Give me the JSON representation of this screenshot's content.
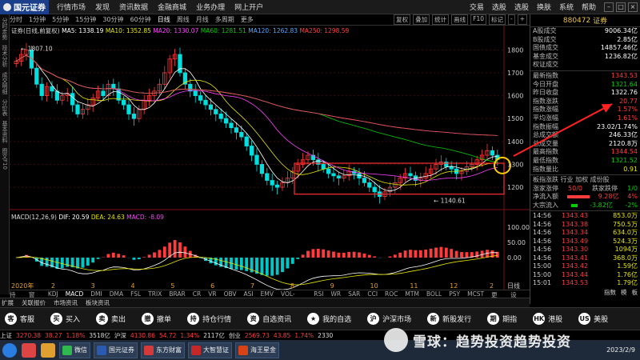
{
  "app": {
    "brand": "国元证券",
    "brand_sub": "GUOYUAN SECURITIES"
  },
  "top_menu": [
    "行情市场",
    "发现",
    "资讯数据",
    "金融商城",
    "业务办理",
    "网上开户"
  ],
  "top_right_menu": [
    "交易",
    "选股",
    "选股",
    "换肤",
    "系统",
    "帮助"
  ],
  "periods": [
    "分时",
    "1分钟",
    "5分钟",
    "15分钟",
    "30分钟",
    "60分钟",
    "日线",
    "周线",
    "月线",
    "多周期",
    "更多"
  ],
  "active_period": "日线",
  "chart_tools": [
    "复权",
    "叠加",
    "统计",
    "画线",
    "F10",
    "标记",
    "-",
    "+"
  ],
  "left_tabs": [
    "分时走势",
    "技术分析",
    "成交明细",
    "分价表",
    "基本资料",
    "图文F10"
  ],
  "ma_legend": {
    "title": "证券(日线,前复权)",
    "items": [
      {
        "label": "MA5: 1338.19",
        "color": "#ffffff"
      },
      {
        "label": "MA10: 1352.85",
        "color": "#e6e600"
      },
      {
        "label": "MA20: 1330.07",
        "color": "#ff40ff"
      },
      {
        "label": "MA60: 1281.51",
        "color": "#00d000"
      },
      {
        "label": "MA120: 1262.83",
        "color": "#4fa8ff"
      },
      {
        "label": "MA250: 1298.59",
        "color": "#ff4040"
      }
    ]
  },
  "macd_legend": {
    "title": "MACD(12,26,9)",
    "dif": "DIF: 20.59",
    "dea": "DEA: 24.63",
    "macd": "MACD: -8.09"
  },
  "annotations": {
    "high": "1807.10",
    "low": "1140.61"
  },
  "chart_data": {
    "type": "candlestick",
    "y_ticks": [
      1800,
      1700,
      1600,
      1500,
      1400,
      1300,
      1200
    ],
    "macd_y_ticks": [
      "100.00",
      "50.00",
      "0.00"
    ],
    "x_labels": [
      "2020年",
      "2",
      "3",
      "4",
      "5",
      "6",
      "7",
      "8",
      "9",
      "10",
      "11",
      "12",
      "2"
    ],
    "x_right_label": "日线",
    "high": 1807.1,
    "low": 1140.61,
    "close": [
      1750,
      1780,
      1800,
      1720,
      1650,
      1600,
      1640,
      1620,
      1580,
      1600,
      1610,
      1560,
      1520,
      1540,
      1560,
      1590,
      1620,
      1600,
      1650,
      1630,
      1580,
      1560,
      1520,
      1500,
      1540,
      1580,
      1600,
      1620,
      1650,
      1700,
      1760,
      1780,
      1700,
      1650,
      1620,
      1600,
      1580,
      1560,
      1540,
      1520,
      1500,
      1480,
      1460,
      1440,
      1420,
      1380,
      1340,
      1300,
      1260,
      1230,
      1210,
      1200,
      1220,
      1240,
      1270,
      1300,
      1320,
      1340,
      1320,
      1300,
      1280,
      1260,
      1250,
      1240,
      1250,
      1270,
      1260,
      1240,
      1220,
      1200,
      1180,
      1160,
      1180,
      1200,
      1220,
      1240,
      1260,
      1250,
      1230,
      1240,
      1260,
      1280,
      1300,
      1310,
      1290,
      1280,
      1260,
      1270,
      1290,
      1300,
      1320,
      1340,
      1360,
      1340,
      1321
    ]
  },
  "stock_panel": {
    "code": "880472",
    "name": "证券",
    "rows1": [
      {
        "k": "A股成交",
        "v": "9006.34亿"
      },
      {
        "k": "B股成交",
        "v": "2.85亿"
      },
      {
        "k": "国债成交",
        "v": "14857.46亿"
      },
      {
        "k": "基金成交",
        "v": "1236.82亿"
      },
      {
        "k": "权证成交",
        "v": ""
      }
    ],
    "rows2": [
      {
        "k": "最新指数",
        "v": "1343.53",
        "c": "red"
      },
      {
        "k": "今日开盘",
        "v": "1321.64",
        "c": "green"
      },
      {
        "k": "昨日收盘",
        "v": "1322.76",
        "c": ""
      },
      {
        "k": "指数涨跌",
        "v": "20.77",
        "c": "red"
      },
      {
        "k": "指数涨幅",
        "v": "1.57%",
        "c": "red"
      },
      {
        "k": "平均涨幅",
        "v": "1.61%",
        "c": "red"
      },
      {
        "k": "指数振幅",
        "v": "23.02/1.74%",
        "c": ""
      },
      {
        "k": "总成交额",
        "v": "246.33亿",
        "c": ""
      },
      {
        "k": "总成交量",
        "v": "2120.8万",
        "c": ""
      },
      {
        "k": "最高指数",
        "v": "1344.54",
        "c": "red"
      },
      {
        "k": "最低指数",
        "v": "1321.52",
        "c": "green"
      },
      {
        "k": "指数量比",
        "v": "0.91",
        "c": "yellow"
      }
    ],
    "tabs_line": "板指涨跌  行业 加权 成份股",
    "up_down": {
      "k1": "涨家涨停",
      "v1": "50/0",
      "k2": "跌家跌停",
      "v2": "1/0"
    },
    "flows": [
      {
        "k": "净流入额",
        "v": "9.28亿",
        "p": "4%",
        "c": "red"
      },
      {
        "k": "大宗流入",
        "v": "-3.82亿",
        "p": "-2%",
        "c": "green"
      }
    ],
    "ticks": [
      {
        "t": "14:56",
        "p": "1343.43",
        "v": "853.0万"
      },
      {
        "t": "14:56",
        "p": "1343.38",
        "v": "750.5万"
      },
      {
        "t": "14:56",
        "p": "1343.34",
        "v": "634.0万"
      },
      {
        "t": "14:56",
        "p": "1343.49",
        "v": "524.3万"
      },
      {
        "t": "14:56",
        "p": "1343.30",
        "v": "1094万"
      },
      {
        "t": "14:56",
        "p": "1343.41",
        "v": "368.0万"
      },
      {
        "t": "15:00",
        "p": "1343.42",
        "v": "1.59亿"
      },
      {
        "t": "15:00",
        "p": "1343.44",
        "v": "1.76亿"
      },
      {
        "t": "15:01",
        "p": "1343.53",
        "v": "1.79亿"
      }
    ]
  },
  "bottom_tabs": [
    "持仓",
    "窗口",
    "KDJ",
    "MACD",
    "DMI",
    "DMA",
    "FSL",
    "TRIX",
    "BRAR",
    "CR",
    "VR",
    "OBV",
    "ASI",
    "EMV",
    "VOL-TDX",
    "RSI",
    "WR",
    "SAR",
    "CCI",
    "ROC",
    "MTM",
    "BOLL",
    "PSY",
    "MCST",
    "更多",
    "设置"
  ],
  "active_bottom_tab": "MACD",
  "sub_tabs": [
    "扩展",
    "关联报价",
    "市场资讯",
    "板块资讯"
  ],
  "panel_tabs": [
    "指数",
    "模",
    "板"
  ],
  "func_bar": [
    {
      "icon": "客",
      "label": "客服"
    },
    {
      "icon": "买",
      "label": "买入"
    },
    {
      "icon": "卖",
      "label": "卖出"
    },
    {
      "icon": "撤",
      "label": "撤单"
    },
    {
      "icon": "持",
      "label": "持仓行情"
    },
    {
      "icon": "资",
      "label": "自选资讯"
    },
    {
      "icon": "★",
      "label": "我的自选"
    },
    {
      "icon": "沪",
      "label": "沪深市场"
    },
    {
      "icon": "新",
      "label": "新股发行"
    },
    {
      "icon": "期",
      "label": "期指"
    },
    {
      "icon": "HK",
      "label": "港股"
    },
    {
      "icon": "US",
      "label": "美股"
    }
  ],
  "ticker": [
    {
      "t": "上证",
      "c": "#ddd"
    },
    {
      "t": "3270.38",
      "c": "#ff3b3b"
    },
    {
      "t": "38.27",
      "c": "#ff3b3b"
    },
    {
      "t": "1.18%",
      "c": "#ff3b3b"
    },
    {
      "t": "3518亿",
      "c": "#ddd"
    },
    {
      "t": "沪深",
      "c": "#ddd"
    },
    {
      "t": "4130.86",
      "c": "#ff3b3b"
    },
    {
      "t": "54.72",
      "c": "#ff3b3b"
    },
    {
      "t": "1.34%",
      "c": "#ff3b3b"
    },
    {
      "t": "2117亿",
      "c": "#ddd"
    },
    {
      "t": "创业",
      "c": "#ddd"
    },
    {
      "t": "2569.73",
      "c": "#ff3b3b"
    },
    {
      "t": "43.85",
      "c": "#ff3b3b"
    },
    {
      "t": "1.74%",
      "c": "#ff3b3b"
    },
    {
      "t": "2330",
      "c": "#ddd"
    }
  ],
  "taskbar": {
    "apps": [
      "微信",
      "国元证券",
      "东方财富",
      "大智慧证",
      "海王星金"
    ],
    "date": "2023/2/9"
  },
  "watermark": {
    "text": "雪球：趋势投资趋势投资"
  }
}
